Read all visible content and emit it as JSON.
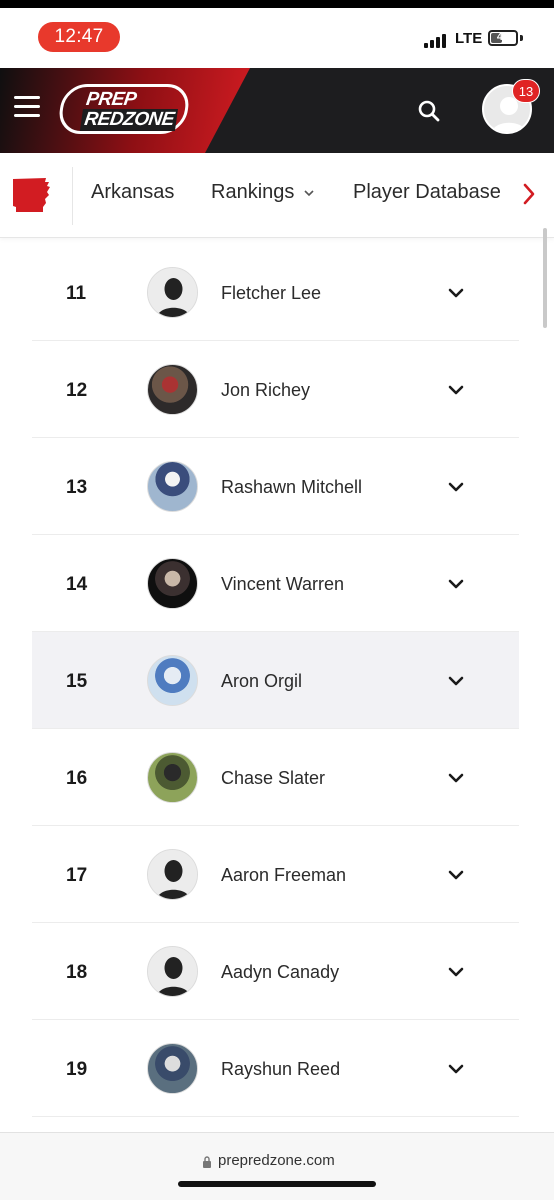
{
  "status_bar": {
    "time": "12:47",
    "network": "LTE",
    "battery": "45",
    "battery_level": 0.45
  },
  "header": {
    "logo_top": "PREP",
    "logo_bottom": "REDZONE",
    "notification_count": "13",
    "colors": {
      "brand_red": "#d21c22",
      "header_bg": "#1d1d1f"
    }
  },
  "subnav": {
    "state_icon": "arkansas-state-icon",
    "items": [
      {
        "label": "Arkansas"
      },
      {
        "label": "Rankings"
      },
      {
        "label": "Player Database"
      }
    ]
  },
  "players": [
    {
      "rank": "11",
      "name": "Fletcher Lee",
      "photo": "placeholder"
    },
    {
      "rank": "12",
      "name": "Jon Richey",
      "photo": "photo"
    },
    {
      "rank": "13",
      "name": "Rashawn Mitchell",
      "photo": "photo"
    },
    {
      "rank": "14",
      "name": "Vincent Warren",
      "photo": "photo"
    },
    {
      "rank": "15",
      "name": "Aron Orgil",
      "photo": "photo"
    },
    {
      "rank": "16",
      "name": "Chase Slater",
      "photo": "photo"
    },
    {
      "rank": "17",
      "name": "Aaron Freeman",
      "photo": "placeholder"
    },
    {
      "rank": "18",
      "name": "Aadyn Canady",
      "photo": "placeholder"
    },
    {
      "rank": "19",
      "name": "Rayshun Reed",
      "photo": "photo"
    }
  ],
  "url_bar": {
    "url": "prepredzone.com"
  }
}
